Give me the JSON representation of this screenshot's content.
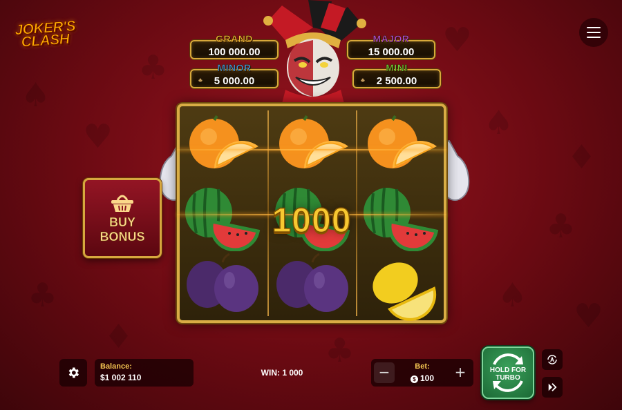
{
  "game": {
    "logo_line1": "JOKER'S",
    "logo_line2": "CLASH"
  },
  "jackpots": [
    {
      "label": "GRAND",
      "value": "100 000.00",
      "color": "#f2b735"
    },
    {
      "label": "MAJOR",
      "value": "15 000.00",
      "color": "#b04ad8"
    },
    {
      "label": "MINOR",
      "value": "5 000.00",
      "color": "#3f95e0"
    },
    {
      "label": "MINI",
      "value": "2 500.00",
      "color": "#6fd33b"
    }
  ],
  "reels": {
    "rows": [
      [
        "orange",
        "orange",
        "orange"
      ],
      [
        "watermelon",
        "watermelon",
        "watermelon"
      ],
      [
        "plum",
        "plum",
        "lemon"
      ]
    ],
    "win_amount": "1000"
  },
  "buy_bonus": {
    "line1": "BUY",
    "line2": "BONUS",
    "icon": "basket-icon"
  },
  "bottom_bar": {
    "balance_label": "Balance:",
    "balance_value": "$1 002 110",
    "win_text": "WIN: 1 000",
    "bet_label": "Bet:",
    "bet_value": "100",
    "bet_currency_symbol": "$",
    "spin_label_line1": "HOLD FOR",
    "spin_label_line2": "TURBO"
  },
  "colors": {
    "background": "#7a0c16",
    "gold_frame": "#d9ad45",
    "spin_button": "#2a8a48",
    "label_gold": "#f3c451"
  }
}
